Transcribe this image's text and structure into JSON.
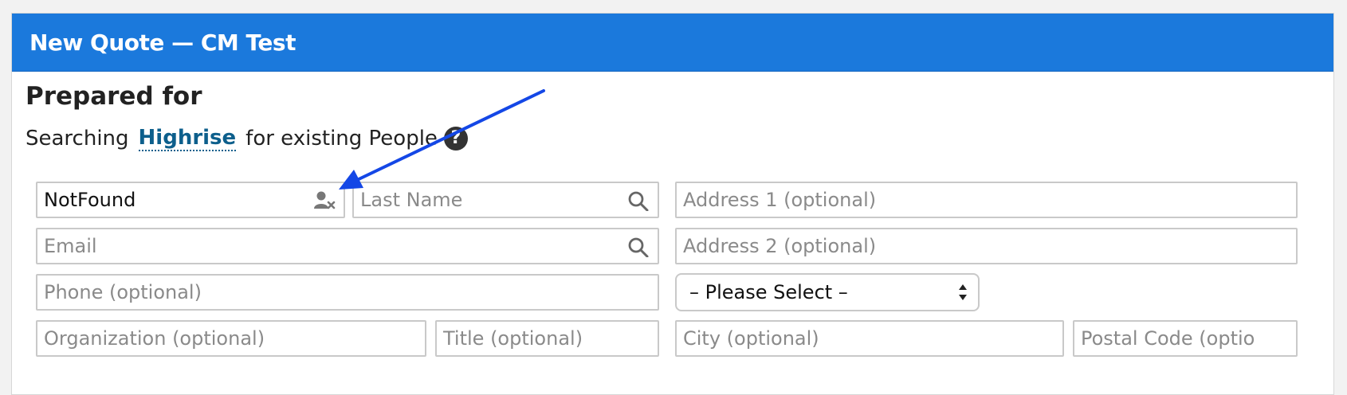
{
  "header": {
    "title": "New Quote — CM Test"
  },
  "prepared_for": {
    "heading": "Prepared for",
    "search_prefix": "Searching",
    "search_source_link": "Highrise",
    "search_suffix": "for existing People",
    "help_glyph": "?"
  },
  "form": {
    "first_name": {
      "value": "NotFound",
      "placeholder": ""
    },
    "last_name": {
      "placeholder": "Last Name"
    },
    "email": {
      "placeholder": "Email"
    },
    "phone": {
      "placeholder": "Phone (optional)"
    },
    "organization": {
      "placeholder": "Organization (optional)"
    },
    "title": {
      "placeholder": "Title (optional)"
    },
    "address1": {
      "placeholder": "Address 1 (optional)"
    },
    "address2": {
      "placeholder": "Address 2 (optional)"
    },
    "state_select": {
      "selected": "– Please Select –"
    },
    "city": {
      "placeholder": "City (optional)"
    },
    "postal_code": {
      "placeholder": "Postal Code (optional)"
    }
  },
  "icons": {
    "first_name_field": "user-remove-icon",
    "last_name_field": "search-icon",
    "email_field": "search-icon",
    "help": "question-circle-icon",
    "select": "select-arrows-icon",
    "annotation": "arrow-annotation"
  },
  "colors": {
    "header_bg": "#1b79dc",
    "link": "#0d5f8c",
    "annotation_arrow": "#1447e6"
  }
}
